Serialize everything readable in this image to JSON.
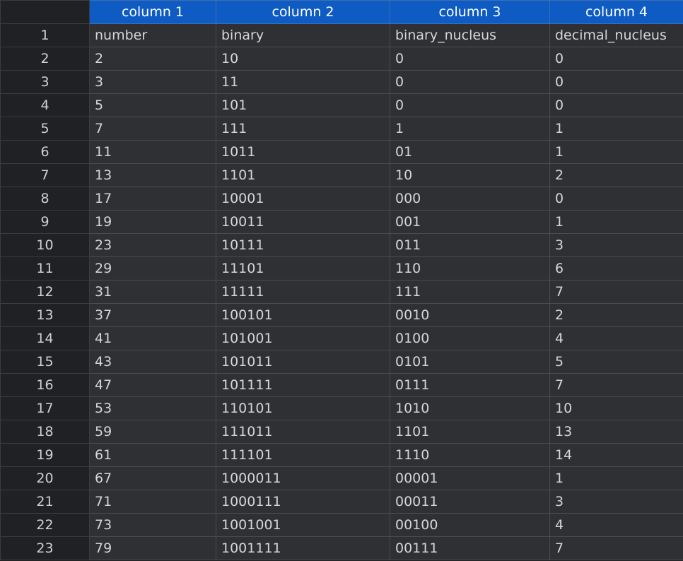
{
  "columns": [
    "column 1",
    "column 2",
    "column 3",
    "column 4"
  ],
  "rows": [
    [
      "1",
      "number",
      "binary",
      "binary_nucleus",
      "decimal_nucleus"
    ],
    [
      "2",
      "2",
      "10",
      "0",
      "0"
    ],
    [
      "3",
      "3",
      "11",
      "0",
      "0"
    ],
    [
      "4",
      "5",
      "101",
      "0",
      "0"
    ],
    [
      "5",
      "7",
      "111",
      "1",
      "1"
    ],
    [
      "6",
      "11",
      "1011",
      "01",
      "1"
    ],
    [
      "7",
      "13",
      "1101",
      "10",
      "2"
    ],
    [
      "8",
      "17",
      "10001",
      "000",
      "0"
    ],
    [
      "9",
      "19",
      "10011",
      "001",
      "1"
    ],
    [
      "10",
      "23",
      "10111",
      "011",
      "3"
    ],
    [
      "11",
      "29",
      "11101",
      "110",
      "6"
    ],
    [
      "12",
      "31",
      "11111",
      "111",
      "7"
    ],
    [
      "13",
      "37",
      "100101",
      "0010",
      "2"
    ],
    [
      "14",
      "41",
      "101001",
      "0100",
      "4"
    ],
    [
      "15",
      "43",
      "101011",
      "0101",
      "5"
    ],
    [
      "16",
      "47",
      "101111",
      "0111",
      "7"
    ],
    [
      "17",
      "53",
      "110101",
      "1010",
      "10"
    ],
    [
      "18",
      "59",
      "111011",
      "1101",
      "13"
    ],
    [
      "19",
      "61",
      "111101",
      "1110",
      "14"
    ],
    [
      "20",
      "67",
      "1000011",
      "00001",
      "1"
    ],
    [
      "21",
      "71",
      "1000111",
      "00011",
      "3"
    ],
    [
      "22",
      "73",
      "1001001",
      "00100",
      "4"
    ],
    [
      "23",
      "79",
      "1001111",
      "00111",
      "7"
    ]
  ]
}
